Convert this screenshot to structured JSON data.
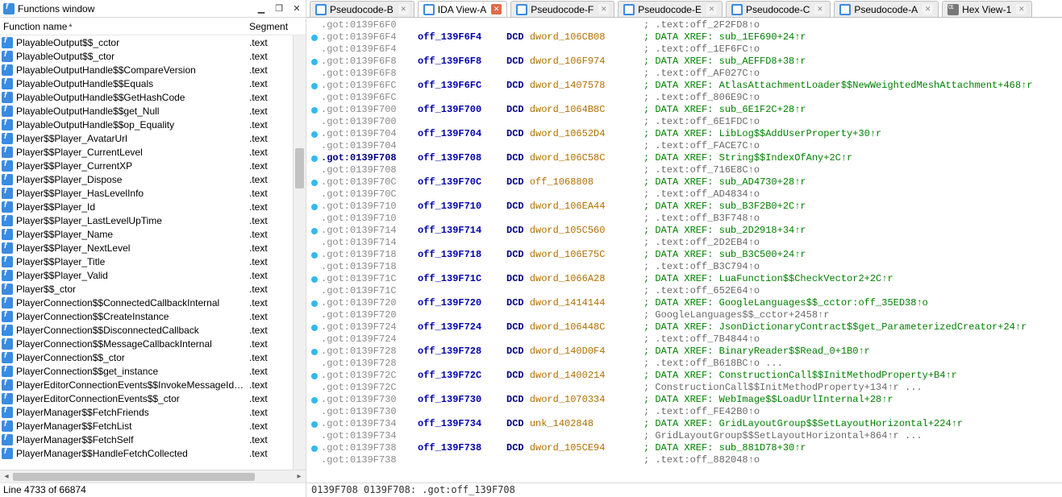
{
  "functions_window": {
    "title": "Functions window",
    "col_name": "Function name",
    "col_seg": "Segment",
    "status": "Line 4733 of 66874",
    "seg_default": ".text",
    "items": [
      "PlayableOutput$$_cctor",
      "PlayableOutput$$_ctor",
      "PlayableOutputHandle$$CompareVersion",
      "PlayableOutputHandle$$Equals",
      "PlayableOutputHandle$$GetHashCode",
      "PlayableOutputHandle$$get_Null",
      "PlayableOutputHandle$$op_Equality",
      "Player$$Player_AvatarUrl",
      "Player$$Player_CurrentLevel",
      "Player$$Player_CurrentXP",
      "Player$$Player_Dispose",
      "Player$$Player_HasLevelInfo",
      "Player$$Player_Id",
      "Player$$Player_LastLevelUpTime",
      "Player$$Player_Name",
      "Player$$Player_NextLevel",
      "Player$$Player_Title",
      "Player$$Player_Valid",
      "Player$$_ctor",
      "PlayerConnection$$ConnectedCallbackInternal",
      "PlayerConnection$$CreateInstance",
      "PlayerConnection$$DisconnectedCallback",
      "PlayerConnection$$MessageCallbackInternal",
      "PlayerConnection$$_ctor",
      "PlayerConnection$$get_instance",
      "PlayerEditorConnectionEvents$$InvokeMessageIdSu…",
      "PlayerEditorConnectionEvents$$_ctor",
      "PlayerManager$$FetchFriends",
      "PlayerManager$$FetchList",
      "PlayerManager$$FetchSelf",
      "PlayerManager$$HandleFetchCollected"
    ]
  },
  "tabs": [
    {
      "label": "Pseudocode-B",
      "icon": "page",
      "active": false
    },
    {
      "label": "IDA View-A",
      "icon": "page",
      "active": true
    },
    {
      "label": "Pseudocode-F",
      "icon": "page",
      "active": false
    },
    {
      "label": "Pseudocode-E",
      "icon": "page",
      "active": false
    },
    {
      "label": "Pseudocode-C",
      "icon": "page",
      "active": false
    },
    {
      "label": "Pseudocode-A",
      "icon": "page",
      "active": false
    },
    {
      "label": "Hex View-1",
      "icon": "hex",
      "active": false
    }
  ],
  "ida": {
    "status": "0139F708 0139F708: .got:off_139F708",
    "rows": [
      {
        "dot": false,
        "addr": ".got:0139F6F0",
        "cur": false,
        "lbl": "",
        "dcd": "",
        "cmt": "; .text:off_2F2FD8↑o"
      },
      {
        "dot": true,
        "addr": ".got:0139F6F4",
        "cur": false,
        "lbl": "off_139F6F4",
        "dcd": "DCD dword_106CB08",
        "cmt": "; DATA XREF: sub_1EF690+24↑r"
      },
      {
        "dot": false,
        "addr": ".got:0139F6F4",
        "cur": false,
        "lbl": "",
        "dcd": "",
        "cmt": "; .text:off_1EF6FC↑o"
      },
      {
        "dot": true,
        "addr": ".got:0139F6F8",
        "cur": false,
        "lbl": "off_139F6F8",
        "dcd": "DCD dword_106F974",
        "cmt": "; DATA XREF: sub_AEFFD8+38↑r"
      },
      {
        "dot": false,
        "addr": ".got:0139F6F8",
        "cur": false,
        "lbl": "",
        "dcd": "",
        "cmt": "; .text:off_AF027C↑o"
      },
      {
        "dot": true,
        "addr": ".got:0139F6FC",
        "cur": false,
        "lbl": "off_139F6FC",
        "dcd": "DCD dword_1407578",
        "cmt": "; DATA XREF: AtlasAttachmentLoader$$NewWeightedMeshAttachment+468↑r"
      },
      {
        "dot": false,
        "addr": ".got:0139F6FC",
        "cur": false,
        "lbl": "",
        "dcd": "",
        "cmt": "; .text:off_806E9C↑o"
      },
      {
        "dot": true,
        "addr": ".got:0139F700",
        "cur": false,
        "lbl": "off_139F700",
        "dcd": "DCD dword_1064B8C",
        "cmt": "; DATA XREF: sub_6E1F2C+28↑r"
      },
      {
        "dot": false,
        "addr": ".got:0139F700",
        "cur": false,
        "lbl": "",
        "dcd": "",
        "cmt": "; .text:off_6E1FDC↑o"
      },
      {
        "dot": true,
        "addr": ".got:0139F704",
        "cur": false,
        "lbl": "off_139F704",
        "dcd": "DCD dword_10652D4",
        "cmt": "; DATA XREF: LibLog$$AddUserProperty+30↑r"
      },
      {
        "dot": false,
        "addr": ".got:0139F704",
        "cur": false,
        "lbl": "",
        "dcd": "",
        "cmt": "; .text:off_FACE7C↑o"
      },
      {
        "dot": true,
        "addr": ".got:0139F708",
        "cur": true,
        "lbl": "off_139F708",
        "dcd": "DCD dword_106C58C",
        "cmt": "; DATA XREF: String$$IndexOfAny+2C↑r"
      },
      {
        "dot": false,
        "addr": ".got:0139F708",
        "cur": false,
        "lbl": "",
        "dcd": "",
        "cmt": "; .text:off_716E8C↑o"
      },
      {
        "dot": true,
        "addr": ".got:0139F70C",
        "cur": false,
        "lbl": "off_139F70C",
        "dcd": "DCD off_1068808",
        "cmt": "; DATA XREF: sub_AD4730+28↑r"
      },
      {
        "dot": false,
        "addr": ".got:0139F70C",
        "cur": false,
        "lbl": "",
        "dcd": "",
        "cmt": "; .text:off_AD4834↑o"
      },
      {
        "dot": true,
        "addr": ".got:0139F710",
        "cur": false,
        "lbl": "off_139F710",
        "dcd": "DCD dword_106EA44",
        "cmt": "; DATA XREF: sub_B3F2B0+2C↑r"
      },
      {
        "dot": false,
        "addr": ".got:0139F710",
        "cur": false,
        "lbl": "",
        "dcd": "",
        "cmt": "; .text:off_B3F748↑o"
      },
      {
        "dot": true,
        "addr": ".got:0139F714",
        "cur": false,
        "lbl": "off_139F714",
        "dcd": "DCD dword_105C560",
        "cmt": "; DATA XREF: sub_2D2918+34↑r"
      },
      {
        "dot": false,
        "addr": ".got:0139F714",
        "cur": false,
        "lbl": "",
        "dcd": "",
        "cmt": "; .text:off_2D2EB4↑o"
      },
      {
        "dot": true,
        "addr": ".got:0139F718",
        "cur": false,
        "lbl": "off_139F718",
        "dcd": "DCD dword_106E75C",
        "cmt": "; DATA XREF: sub_B3C500+24↑r"
      },
      {
        "dot": false,
        "addr": ".got:0139F718",
        "cur": false,
        "lbl": "",
        "dcd": "",
        "cmt": "; .text:off_B3C794↑o"
      },
      {
        "dot": true,
        "addr": ".got:0139F71C",
        "cur": false,
        "lbl": "off_139F71C",
        "dcd": "DCD dword_1066A28",
        "cmt": "; DATA XREF: LuaFunction$$CheckVector2+2C↑r"
      },
      {
        "dot": false,
        "addr": ".got:0139F71C",
        "cur": false,
        "lbl": "",
        "dcd": "",
        "cmt": "; .text:off_652E64↑o"
      },
      {
        "dot": true,
        "addr": ".got:0139F720",
        "cur": false,
        "lbl": "off_139F720",
        "dcd": "DCD dword_1414144",
        "cmt": "; DATA XREF: GoogleLanguages$$_cctor:off_35ED38↑o"
      },
      {
        "dot": false,
        "addr": ".got:0139F720",
        "cur": false,
        "lbl": "",
        "dcd": "",
        "cmt": "; GoogleLanguages$$_cctor+2458↑r"
      },
      {
        "dot": true,
        "addr": ".got:0139F724",
        "cur": false,
        "lbl": "off_139F724",
        "dcd": "DCD dword_106448C",
        "cmt": "; DATA XREF: JsonDictionaryContract$$get_ParameterizedCreator+24↑r"
      },
      {
        "dot": false,
        "addr": ".got:0139F724",
        "cur": false,
        "lbl": "",
        "dcd": "",
        "cmt": "; .text:off_7B4844↑o"
      },
      {
        "dot": true,
        "addr": ".got:0139F728",
        "cur": false,
        "lbl": "off_139F728",
        "dcd": "DCD dword_140D0F4",
        "cmt": "; DATA XREF: BinaryReader$$Read_0+1B0↑r"
      },
      {
        "dot": false,
        "addr": ".got:0139F728",
        "cur": false,
        "lbl": "",
        "dcd": "",
        "cmt": "; .text:off_B618BC↑o ..."
      },
      {
        "dot": true,
        "addr": ".got:0139F72C",
        "cur": false,
        "lbl": "off_139F72C",
        "dcd": "DCD dword_1400214",
        "cmt": "; DATA XREF: ConstructionCall$$InitMethodProperty+B4↑r"
      },
      {
        "dot": false,
        "addr": ".got:0139F72C",
        "cur": false,
        "lbl": "",
        "dcd": "",
        "cmt": "; ConstructionCall$$InitMethodProperty+134↑r ..."
      },
      {
        "dot": true,
        "addr": ".got:0139F730",
        "cur": false,
        "lbl": "off_139F730",
        "dcd": "DCD dword_1070334",
        "cmt": "; DATA XREF: WebImage$$LoadUrlInternal+28↑r"
      },
      {
        "dot": false,
        "addr": ".got:0139F730",
        "cur": false,
        "lbl": "",
        "dcd": "",
        "cmt": "; .text:off_FE42B0↑o"
      },
      {
        "dot": true,
        "addr": ".got:0139F734",
        "cur": false,
        "lbl": "off_139F734",
        "dcd": "DCD unk_1402848",
        "cmt": "; DATA XREF: GridLayoutGroup$$SetLayoutHorizontal+224↑r"
      },
      {
        "dot": false,
        "addr": ".got:0139F734",
        "cur": false,
        "lbl": "",
        "dcd": "",
        "cmt": "; GridLayoutGroup$$SetLayoutHorizontal+864↑r ..."
      },
      {
        "dot": true,
        "addr": ".got:0139F738",
        "cur": false,
        "lbl": "off_139F738",
        "dcd": "DCD dword_105CE94",
        "cmt": "; DATA XREF: sub_881D78+30↑r"
      },
      {
        "dot": false,
        "addr": ".got:0139F738",
        "cur": false,
        "lbl": "",
        "dcd": "",
        "cmt": "; .text:off_882048↑o"
      }
    ]
  }
}
